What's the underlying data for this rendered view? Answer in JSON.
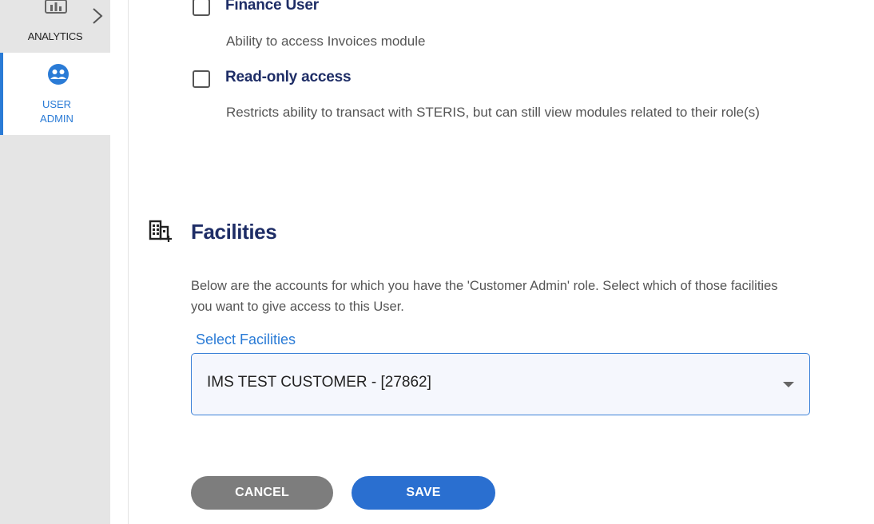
{
  "sidebar": {
    "items": [
      {
        "label": "ANALYTICS",
        "icon": "analytics-icon"
      },
      {
        "label": "USER\nADMIN",
        "icon": "user-admin-icon",
        "active": true
      }
    ],
    "accent": "#2a7bd6"
  },
  "roles": [
    {
      "title": "Finance User",
      "description": "Ability to access Invoices module",
      "checked": false
    },
    {
      "title": "Read-only access",
      "description": "Restricts ability to transact with STERIS, but can still view modules related to their role(s)",
      "checked": false
    }
  ],
  "facilities": {
    "title": "Facilities",
    "description": "Below are the accounts for which you have the 'Customer Admin' role. Select which of those facilities you want to give access to this User.",
    "select_label": "Select Facilities",
    "select_value": "IMS TEST CUSTOMER - [27862]"
  },
  "actions": {
    "cancel_label": "CANCEL",
    "save_label": "SAVE"
  },
  "colors": {
    "heading": "#1e2d66",
    "link": "#2a7bd6",
    "save": "#2a6fd0",
    "cancel": "#7d7d7d"
  }
}
